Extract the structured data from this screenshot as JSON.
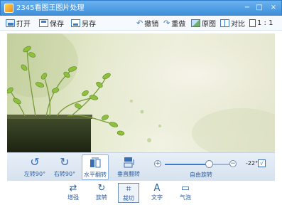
{
  "window": {
    "title": "2345看图王图片处理",
    "minimize": "−",
    "maximize": "□",
    "close": "×"
  },
  "toolbar": {
    "open": "打开",
    "save": "保存",
    "save_as": "另存",
    "undo": "撤销",
    "redo": "重做",
    "original": "原图",
    "compare": "对比",
    "ratio": "1 : 1"
  },
  "edit_tools": [
    {
      "label": "左转90°",
      "icon": "rotate-left-icon"
    },
    {
      "label": "右转90°",
      "icon": "rotate-right-icon"
    },
    {
      "label": "水平翻转",
      "icon": "flip-horizontal-icon"
    },
    {
      "label": "垂直翻转",
      "icon": "flip-vertical-icon"
    }
  ],
  "rotation": {
    "label": "自由旋转",
    "angle": "-22°",
    "confirm": "√",
    "level": 0.62,
    "minus": "−",
    "plus": "+"
  },
  "tabs": [
    {
      "label": "增强",
      "icon": "enhance-icon",
      "glyph": "⇄"
    },
    {
      "label": "旋转",
      "icon": "rotate-icon",
      "glyph": "↻"
    },
    {
      "label": "裁切",
      "icon": "crop-icon",
      "glyph": "⌗"
    },
    {
      "label": "文字",
      "icon": "text-icon",
      "glyph": "A"
    },
    {
      "label": "气泡",
      "icon": "bubble-icon",
      "glyph": "▭"
    }
  ],
  "colors": {
    "accent": "#3a7cc6",
    "titlebar": "#4a9be4"
  }
}
